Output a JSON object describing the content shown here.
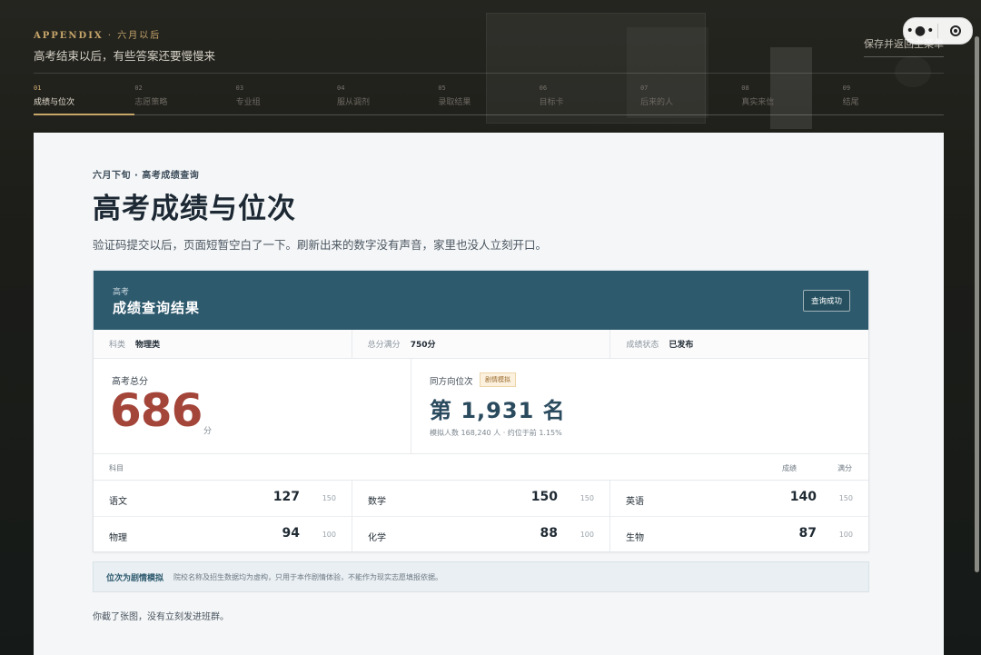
{
  "header": {
    "eyebrow_en": "APPENDIX",
    "eyebrow_sep": " · ",
    "eyebrow_cn": "六月以后",
    "subtitle": "高考结束以后，有些答案还要慢慢来",
    "save_label": "保存并返回主菜单"
  },
  "capsule": {
    "more": "•●•"
  },
  "tabs": [
    {
      "num": "01",
      "label": "成绩与位次"
    },
    {
      "num": "02",
      "label": "志愿策略"
    },
    {
      "num": "03",
      "label": "专业组"
    },
    {
      "num": "04",
      "label": "服从调剂"
    },
    {
      "num": "05",
      "label": "录取结果"
    },
    {
      "num": "06",
      "label": "目标卡"
    },
    {
      "num": "07",
      "label": "后来的人"
    },
    {
      "num": "08",
      "label": "真实来信"
    },
    {
      "num": "09",
      "label": "结尾"
    }
  ],
  "active_tab_index": 0,
  "page": {
    "eyebrow": "六月下旬 · 高考成绩查询",
    "title": "高考成绩与位次",
    "description": "验证码提交以后，页面短暂空白了一下。刷新出来的数字没有声音，家里也没人立刻开口。"
  },
  "result": {
    "small_label": "高考",
    "title": "成绩查询结果",
    "status_button": "查询成功",
    "info": [
      {
        "label": "科类",
        "value": "物理类"
      },
      {
        "label": "总分满分",
        "value": "750分"
      },
      {
        "label": "成绩状态",
        "value": "已发布"
      }
    ],
    "total_label": "高考总分",
    "total_score": "686",
    "total_unit": "分",
    "rank_label": "同方向位次",
    "rank_badge": "剧情模拟",
    "rank_value": "第 1,931 名",
    "rank_note": "模拟人数 168,240 人 · 约位于前 1.15%",
    "subjects_header": {
      "subject": "科目",
      "score": "成绩",
      "full": "满分"
    },
    "subjects": [
      {
        "name": "语文",
        "score": "127",
        "full": "150"
      },
      {
        "name": "数学",
        "score": "150",
        "full": "150"
      },
      {
        "name": "英语",
        "score": "140",
        "full": "150"
      },
      {
        "name": "物理",
        "score": "94",
        "full": "100"
      },
      {
        "name": "化学",
        "score": "88",
        "full": "100"
      },
      {
        "name": "生物",
        "score": "87",
        "full": "100"
      }
    ]
  },
  "disclaimer": {
    "title": "位次为剧情模拟",
    "text": "院校名称及招生数据均为虚构，只用于本作剧情体验，不能作为现实志愿填报依据。"
  },
  "footnote": "你截了张图，没有立刻发进班群。",
  "colors": {
    "accent_gold": "#c7a66a",
    "header_teal": "#2e5a6e",
    "score_red": "#a4453a"
  }
}
